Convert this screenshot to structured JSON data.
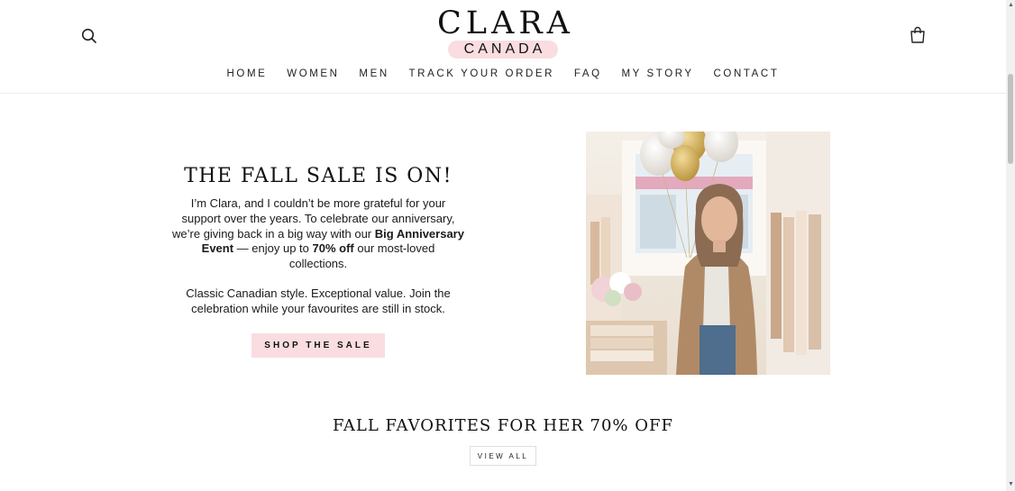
{
  "header": {
    "logo_brand": "CLARA",
    "logo_sub": "CANADA",
    "nav": [
      "HOME",
      "WOMEN",
      "MEN",
      "TRACK YOUR ORDER",
      "FAQ",
      "MY STORY",
      "CONTACT"
    ]
  },
  "hero": {
    "title": "THE FALL SALE IS ON!",
    "p1_a": "I’m Clara, and I couldn’t be more grateful for your support over the years. To celebrate our anniversary, we’re giving back in a big way with our ",
    "p1_bold1": "Big Anniversary Event",
    "p1_b": " — enjoy up to ",
    "p1_bold2": "70% off",
    "p1_c": " our most-loved collections.",
    "p2": "Classic Canadian style. Exceptional value. Join the celebration while your favourites are still in stock.",
    "cta": "SHOP THE SALE"
  },
  "collection": {
    "title": "FALL FAVORITES FOR HER 70% OFF",
    "view_all": "VIEW ALL"
  },
  "icons": {
    "search": "search-icon",
    "cart": "shopping-bag-icon"
  },
  "colors": {
    "accent_pink": "#f9dde0"
  }
}
